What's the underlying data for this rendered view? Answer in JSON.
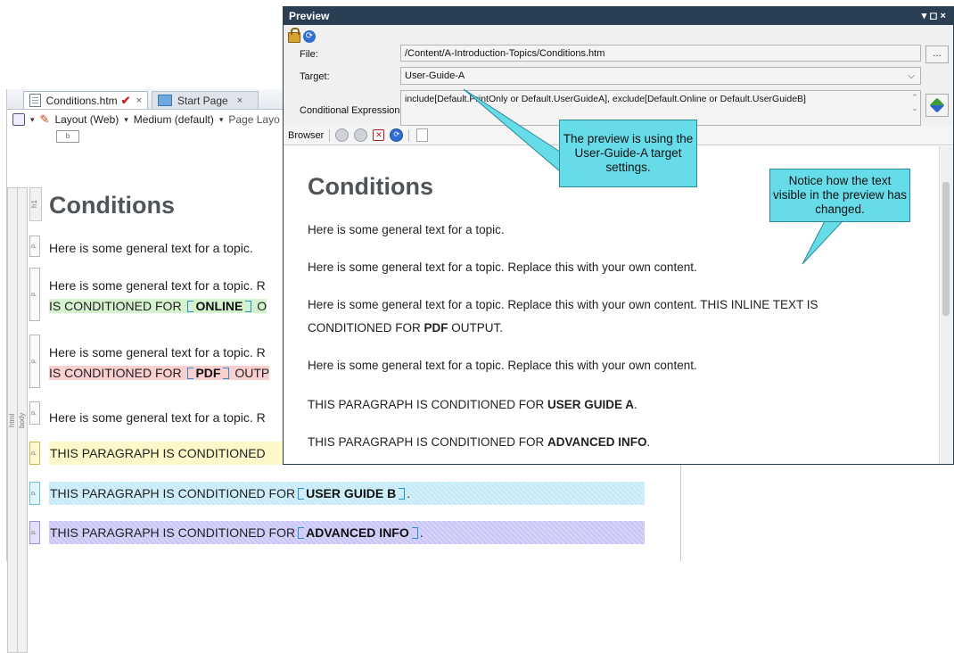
{
  "editor": {
    "tabs": [
      {
        "label": "Conditions.htm",
        "modified_mark": "✔",
        "close": "×"
      },
      {
        "label": "Start Page",
        "close": "×"
      }
    ],
    "toolbar": {
      "layout": "Layout (Web)",
      "medium": "Medium (default)",
      "page_layout": "Page Layo"
    },
    "b_label": "b",
    "rulers": {
      "html": "html",
      "body": "body",
      "h1": "h1"
    },
    "marker_p": "p",
    "heading": "Conditions",
    "paragraphs": {
      "p1": "Here is some general text for a topic.",
      "p2a": "Here is some general text for a topic. R",
      "p2b_pre": "IS CONDITIONED FOR ",
      "p2b_bold": "ONLINE",
      "p2b_post": " O",
      "p3a": "Here is some general text for a topic. R",
      "p3b_pre": "IS CONDITIONED FOR ",
      "p3b_bold": "PDF",
      "p3b_post": " OUTP",
      "p4": "Here is some general text for a topic. R",
      "p5": "THIS PARAGRAPH IS CONDITIONED",
      "p6_pre": "THIS PARAGRAPH IS CONDITIONED FOR ",
      "p6_bold": "USER GUIDE B",
      "p6_post": ".",
      "p7_pre": "THIS PARAGRAPH IS CONDITIONED FOR ",
      "p7_bold": "ADVANCED INFO",
      "p7_post": "."
    },
    "colors": {
      "online": "#d5f2cf",
      "pdf": "#f9cfd0",
      "user_guide_a": "#fef7c7",
      "user_guide_b": "#c4e9f7",
      "advanced": "#c9c4f6"
    }
  },
  "preview": {
    "title": "Preview",
    "window_buttons": "▾ ◻ ×",
    "file_label": "File:",
    "file_value": "/Content/A-Introduction-Topics/Conditions.htm",
    "browse_label": "...",
    "target_label": "Target:",
    "target_value": "User-Guide-A",
    "expression_label": "Conditional Expression:",
    "expression_value": "include[Default.PrintOnly or Default.UserGuideA], exclude[Default.Online or Default.UserGuideB]",
    "browser_label": "Browser",
    "content": {
      "heading": "Conditions",
      "p1": "Here is some general text for a topic.",
      "p2": "Here is some general text for a topic. Replace this with your own content.",
      "p3a": "Here is some general text for a topic. Replace this with your own content. THIS INLINE TEXT IS",
      "p3b_pre": "CONDITIONED FOR ",
      "p3b_bold": "PDF",
      "p3b_post": " OUTPUT.",
      "p4": "Here is some general text for a topic. Replace this with your own content.",
      "p5_pre": "THIS PARAGRAPH IS CONDITIONED FOR ",
      "p5_bold": "USER GUIDE A",
      "p5_post": ".",
      "p6_pre": "THIS PARAGRAPH IS CONDITIONED FOR ",
      "p6_bold": "ADVANCED INFO",
      "p6_post": "."
    }
  },
  "callouts": {
    "c1": "The preview is using the User-Guide-A target settings.",
    "c2": "Notice how the text visible in the preview has changed.",
    "color": "#66dce8"
  }
}
